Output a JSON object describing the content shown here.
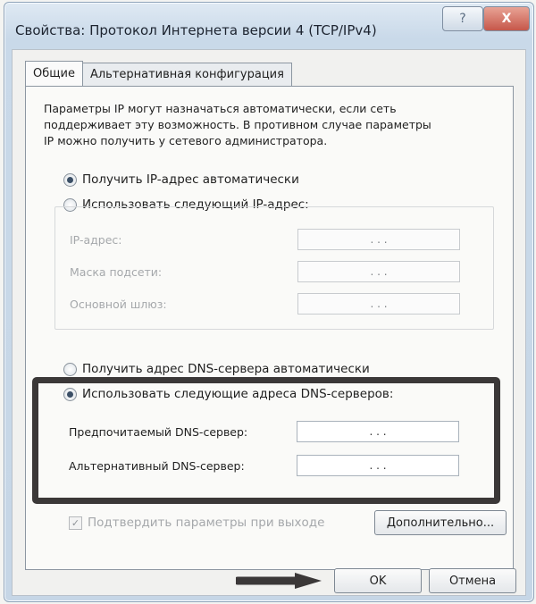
{
  "window": {
    "title": "Свойства: Протокол Интернета версии 4 (TCP/IPv4)",
    "help_glyph": "?",
    "close_glyph": "X"
  },
  "tabs": [
    {
      "label": "Общие",
      "active": true
    },
    {
      "label": "Альтернативная конфигурация",
      "active": false
    }
  ],
  "intro_text": "Параметры IP могут назначаться автоматически, если сеть\nподдерживает эту возможность. В противном случае параметры\nIP можно получить у сетевого администратора.",
  "ip_section": {
    "auto_label": "Получить IP-адрес автоматически",
    "manual_label": "Использовать следующий IP-адрес:",
    "selected": "auto",
    "fields": [
      {
        "label": "IP-адрес:",
        "value": ". . ."
      },
      {
        "label": "Маска подсети:",
        "value": ". . ."
      },
      {
        "label": "Основной шлюз:",
        "value": ". . ."
      }
    ]
  },
  "dns_section": {
    "auto_label": "Получить адрес DNS-сервера автоматически",
    "manual_label": "Использовать следующие адреса DNS-серверов:",
    "selected": "manual",
    "fields": [
      {
        "label": "Предпочитаемый DNS-сервер:",
        "value": ". . ."
      },
      {
        "label": "Альтернативный DNS-сервер:",
        "value": ". . ."
      }
    ]
  },
  "validate_checkbox": {
    "label": "Подтвердить параметры при выходе",
    "checked": true,
    "mark": "✓"
  },
  "buttons": {
    "advanced": "Дополнительно...",
    "ok": "OK",
    "cancel": "Отмена"
  },
  "colors": {
    "highlight_border": "#3b3838",
    "arrow": "#3b3838"
  }
}
